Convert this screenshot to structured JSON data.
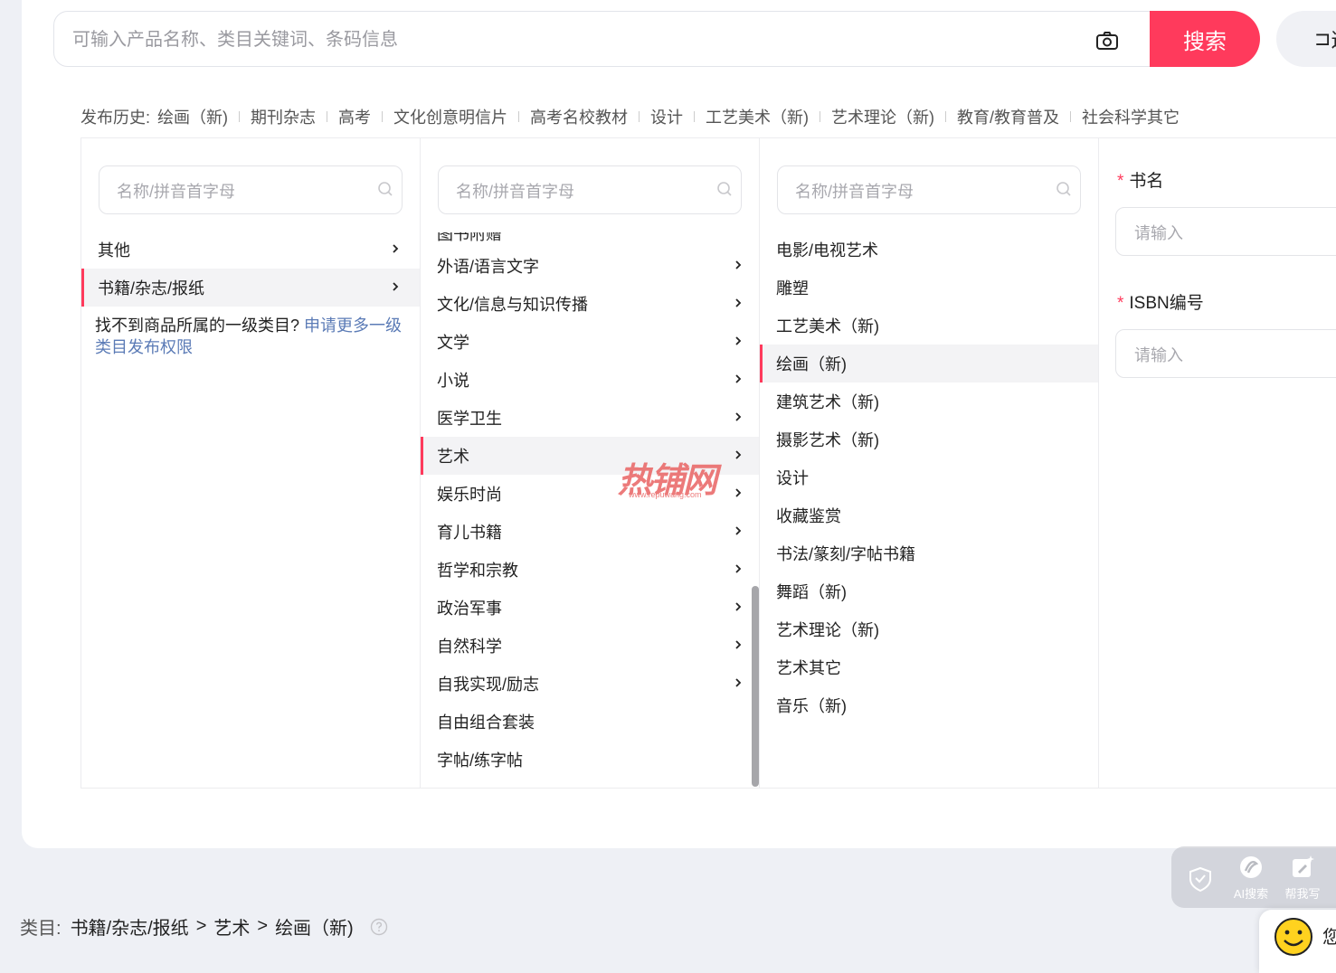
{
  "search": {
    "placeholder": "可输入产品名称、类目关键词、条码信息",
    "button_label": "搜索",
    "filter_label": "⊐",
    "filter_text": "这"
  },
  "history": {
    "label": "发布历史:",
    "items": [
      "绘画（新)",
      "期刊杂志",
      "高考",
      "文化创意明信片",
      "高考名校教材",
      "设计",
      "工艺美术（新)",
      "艺术理论（新)",
      "教育/教育普及",
      "社会科学其它"
    ]
  },
  "picker": {
    "search_placeholder": "名称/拼音首字母",
    "col1": {
      "items": [
        {
          "label": "其他",
          "has_children": true,
          "selected": false
        },
        {
          "label": "书籍/杂志/报纸",
          "has_children": true,
          "selected": true
        }
      ],
      "not_found_text": "找不到商品所属的一级类目?",
      "not_found_link": "申请更多一级类目发布权限"
    },
    "col2": {
      "partial_item": "图书附赠",
      "items": [
        {
          "label": "外语/语言文字",
          "has_children": true,
          "selected": false
        },
        {
          "label": "文化/信息与知识传播",
          "has_children": true,
          "selected": false
        },
        {
          "label": "文学",
          "has_children": true,
          "selected": false
        },
        {
          "label": "小说",
          "has_children": true,
          "selected": false
        },
        {
          "label": "医学卫生",
          "has_children": true,
          "selected": false
        },
        {
          "label": "艺术",
          "has_children": true,
          "selected": true
        },
        {
          "label": "娱乐时尚",
          "has_children": true,
          "selected": false
        },
        {
          "label": "育儿书籍",
          "has_children": true,
          "selected": false
        },
        {
          "label": "哲学和宗教",
          "has_children": true,
          "selected": false
        },
        {
          "label": "政治军事",
          "has_children": true,
          "selected": false
        },
        {
          "label": "自然科学",
          "has_children": true,
          "selected": false
        },
        {
          "label": "自我实现/励志",
          "has_children": true,
          "selected": false
        },
        {
          "label": "自由组合套装",
          "has_children": false,
          "selected": false
        },
        {
          "label": "字帖/练字帖",
          "has_children": false,
          "selected": false
        }
      ]
    },
    "col3": {
      "items": [
        {
          "label": "电影/电视艺术",
          "selected": false
        },
        {
          "label": "雕塑",
          "selected": false
        },
        {
          "label": "工艺美术（新)",
          "selected": false
        },
        {
          "label": "绘画（新)",
          "selected": true
        },
        {
          "label": "建筑艺术（新)",
          "selected": false
        },
        {
          "label": "摄影艺术（新)",
          "selected": false
        },
        {
          "label": "设计",
          "selected": false
        },
        {
          "label": "收藏鉴赏",
          "selected": false
        },
        {
          "label": "书法/篆刻/字帖书籍",
          "selected": false
        },
        {
          "label": "舞蹈（新)",
          "selected": false
        },
        {
          "label": "艺术理论（新)",
          "selected": false
        },
        {
          "label": "艺术其它",
          "selected": false
        },
        {
          "label": "音乐（新)",
          "selected": false
        }
      ]
    }
  },
  "form": {
    "required_mark": "*",
    "book_name_label": "书名",
    "book_name_placeholder": "请输入",
    "isbn_label": "ISBN编号",
    "isbn_placeholder": "请输入"
  },
  "watermark": {
    "main": "热铺网",
    "sub": "www.repuwang.com"
  },
  "breadcrumb": {
    "label": "类目:",
    "path": [
      "书籍/杂志/报纸",
      "艺术",
      "绘画（新)"
    ],
    "separator": ">"
  },
  "assist": {
    "ai_search": "AI搜索",
    "help_write": "帮我写"
  },
  "chat": {
    "text": "您"
  },
  "colors": {
    "accent": "#ff3a5c",
    "link": "#5b7bb6",
    "selected_bg": "#f3f3f5",
    "page_bg": "#eef0f5"
  }
}
